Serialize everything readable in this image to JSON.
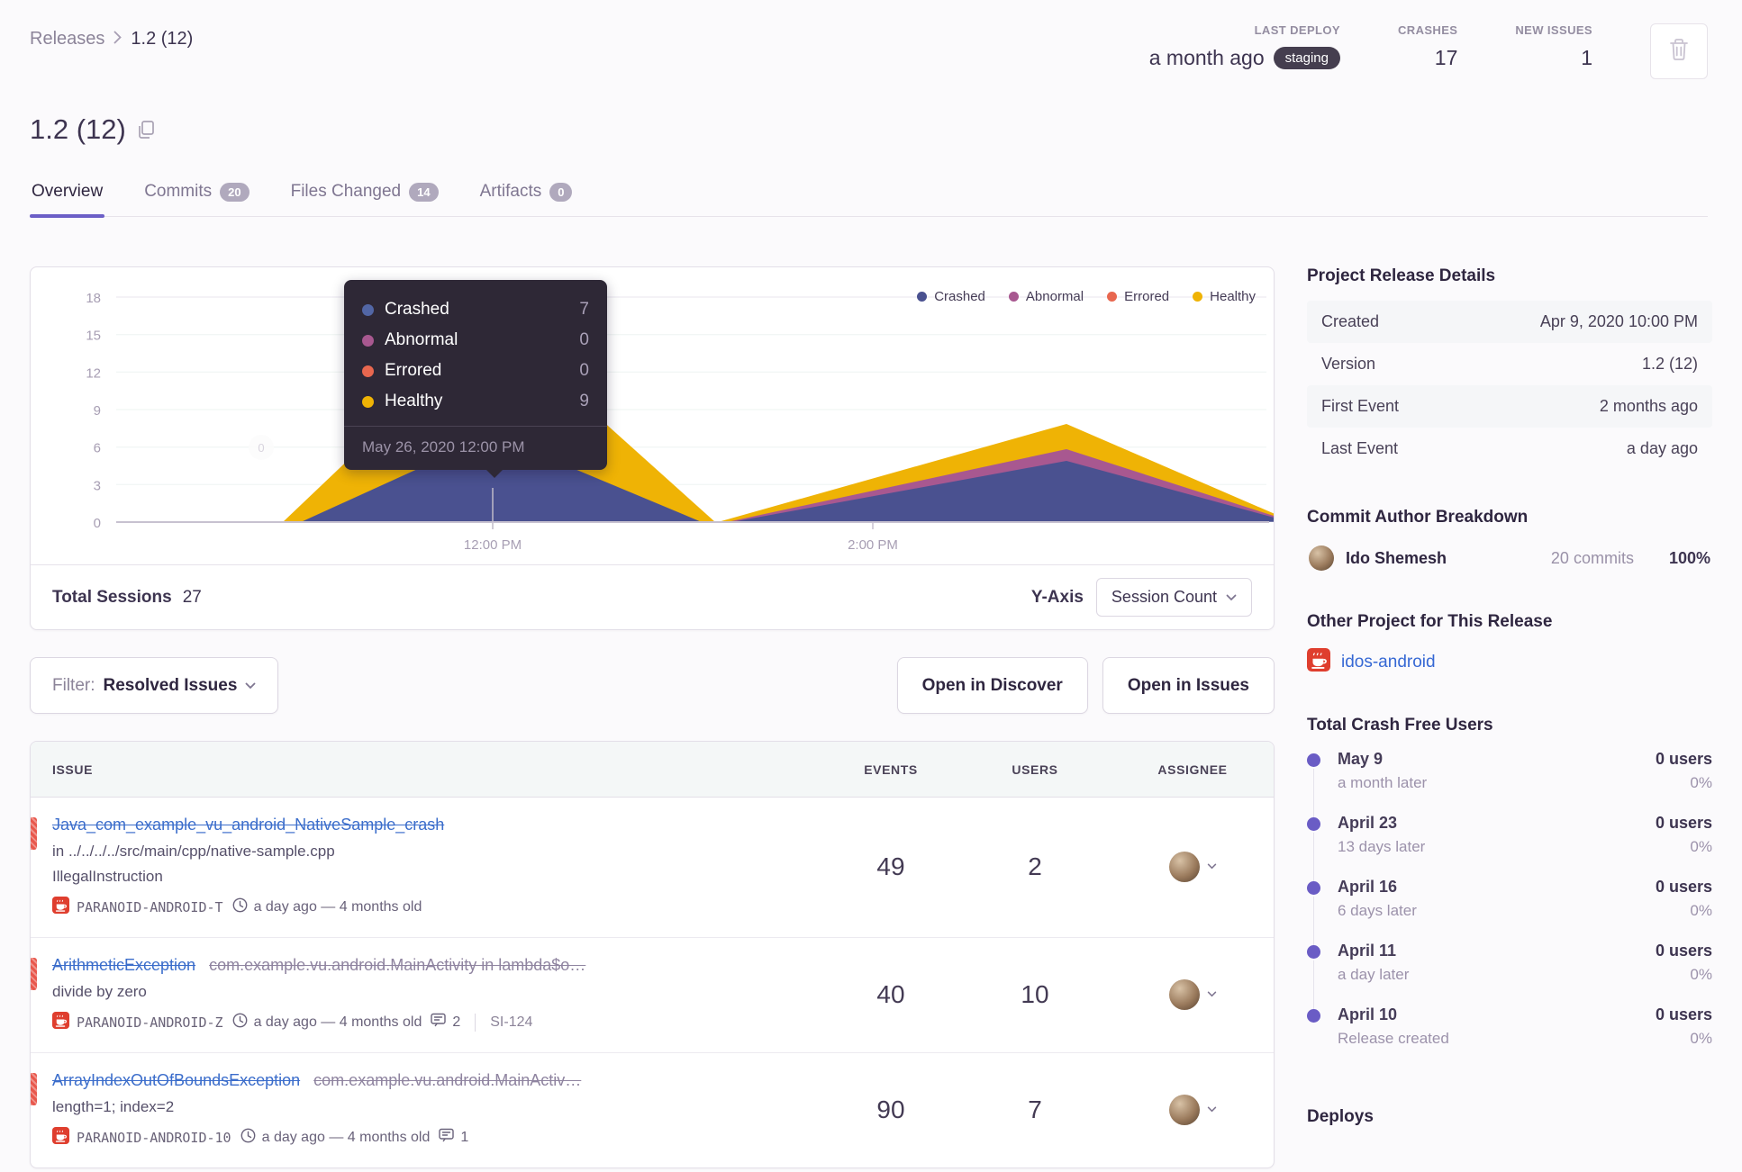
{
  "breadcrumb": {
    "root": "Releases",
    "current": "1.2 (12)"
  },
  "header": {
    "title": "1.2 (12)",
    "stats": [
      {
        "label": "LAST DEPLOY",
        "value": "a month ago",
        "badge": "staging"
      },
      {
        "label": "CRASHES",
        "value": "17"
      },
      {
        "label": "NEW ISSUES",
        "value": "1"
      }
    ]
  },
  "tabs": [
    {
      "label": "Overview",
      "count": ""
    },
    {
      "label": "Commits",
      "count": "20"
    },
    {
      "label": "Files Changed",
      "count": "14"
    },
    {
      "label": "Artifacts",
      "count": "0"
    }
  ],
  "chart": {
    "yticks": [
      "18",
      "15",
      "12",
      "9",
      "6",
      "3",
      "0"
    ],
    "xticks": [
      "12:00 PM",
      "2:00 PM"
    ],
    "stray_label": "0",
    "legend": [
      {
        "label": "Crashed"
      },
      {
        "label": "Abnormal"
      },
      {
        "label": "Errored"
      },
      {
        "label": "Healthy"
      }
    ],
    "tooltip": {
      "rows": [
        {
          "label": "Crashed",
          "value": "7"
        },
        {
          "label": "Abnormal",
          "value": "0"
        },
        {
          "label": "Errored",
          "value": "0"
        },
        {
          "label": "Healthy",
          "value": "9"
        }
      ],
      "date": "May 26, 2020 12:00 PM"
    },
    "footer": {
      "sessions_label": "Total Sessions",
      "sessions_value": "27",
      "yaxis_label": "Y-Axis",
      "yaxis_value": "Session Count"
    }
  },
  "chart_data": {
    "type": "area",
    "title": "Release session health over time",
    "x": [
      "11:00 AM",
      "12:00 PM",
      "1:00 PM",
      "2:00 PM",
      "3:00 PM",
      "4:00 PM"
    ],
    "series": [
      {
        "name": "Crashed",
        "color": "#4a5190",
        "values": [
          0,
          7,
          0,
          3,
          5,
          0
        ]
      },
      {
        "name": "Abnormal",
        "color": "#a85890",
        "values": [
          0,
          0,
          0,
          0,
          1,
          0
        ]
      },
      {
        "name": "Errored",
        "color": "#e8674f",
        "values": [
          0,
          0,
          0,
          0,
          0,
          0
        ]
      },
      {
        "name": "Healthy",
        "color": "#efb305",
        "values": [
          0,
          9,
          0,
          4,
          3,
          0
        ]
      }
    ],
    "stacked": true,
    "ylim": [
      0,
      18
    ],
    "yticks": [
      0,
      3,
      6,
      9,
      12,
      15,
      18
    ],
    "xticks_shown": [
      "12:00 PM",
      "2:00 PM"
    ],
    "legend_position": "top-right",
    "grid": true,
    "tooltip_point": {
      "date": "May 26, 2020 12:00 PM",
      "Crashed": 7,
      "Abnormal": 0,
      "Errored": 0,
      "Healthy": 9
    },
    "total_sessions": 27,
    "yaxis_mode": "Session Count"
  },
  "filter": {
    "label": "Filter:",
    "value": "Resolved Issues"
  },
  "actions": {
    "discover": "Open in Discover",
    "issues": "Open in Issues"
  },
  "issues": {
    "headers": [
      "ISSUE",
      "EVENTS",
      "USERS",
      "ASSIGNEE"
    ],
    "rows": [
      {
        "title": "Java_com_example_vu_android_NativeSample_crash",
        "culprit": "",
        "sub1": "in ../../../../src/main/cpp/native-sample.cpp",
        "sub2": "IllegalInstruction",
        "project": "PARANOID-ANDROID-T",
        "age": "a day ago — 4 months old",
        "comments": "",
        "short_id": "",
        "events": "49",
        "users": "2"
      },
      {
        "title": "ArithmeticException",
        "culprit": "com.example.vu.android.MainActivity in lambda$o…",
        "sub1": "divide by zero",
        "sub2": "",
        "project": "PARANOID-ANDROID-Z",
        "age": "a day ago — 4 months old",
        "comments": "2",
        "short_id": "SI-124",
        "events": "40",
        "users": "10"
      },
      {
        "title": "ArrayIndexOutOfBoundsException",
        "culprit": "com.example.vu.android.MainActiv…",
        "sub1": "length=1; index=2",
        "sub2": "",
        "project": "PARANOID-ANDROID-10",
        "age": "a day ago — 4 months old",
        "comments": "1",
        "short_id": "",
        "events": "90",
        "users": "7"
      }
    ]
  },
  "sidebar": {
    "details": {
      "title": "Project Release Details",
      "rows": [
        {
          "label": "Created",
          "value": "Apr 9, 2020 10:00 PM"
        },
        {
          "label": "Version",
          "value": "1.2 (12)"
        },
        {
          "label": "First Event",
          "value": "2 months ago"
        },
        {
          "label": "Last Event",
          "value": "a day ago"
        }
      ]
    },
    "commit": {
      "title": "Commit Author Breakdown",
      "author": "Ido Shemesh",
      "commits": "20 commits",
      "percent": "100%"
    },
    "other": {
      "title": "Other Project for This Release",
      "project": "idos-android"
    },
    "crashfree": {
      "title": "Total Crash Free Users",
      "items": [
        {
          "date": "May 9",
          "sub": "a month later",
          "users": "0 users",
          "percent": "0%"
        },
        {
          "date": "April 23",
          "sub": "13 days later",
          "users": "0 users",
          "percent": "0%"
        },
        {
          "date": "April 16",
          "sub": "6 days later",
          "users": "0 users",
          "percent": "0%"
        },
        {
          "date": "April 11",
          "sub": "a day later",
          "users": "0 users",
          "percent": "0%"
        },
        {
          "date": "April 10",
          "sub": "Release created",
          "users": "0 users",
          "percent": "0%"
        }
      ]
    },
    "deploys_title": "Deploys"
  },
  "colors": {
    "crashed": "#4a5190",
    "abnormal": "#a85890",
    "errored": "#e8674f",
    "healthy": "#efb305",
    "accent": "#6c5fc7",
    "link": "#3b6dcb",
    "level_red": "#e8574c",
    "staging_pill": "#453e4f"
  }
}
